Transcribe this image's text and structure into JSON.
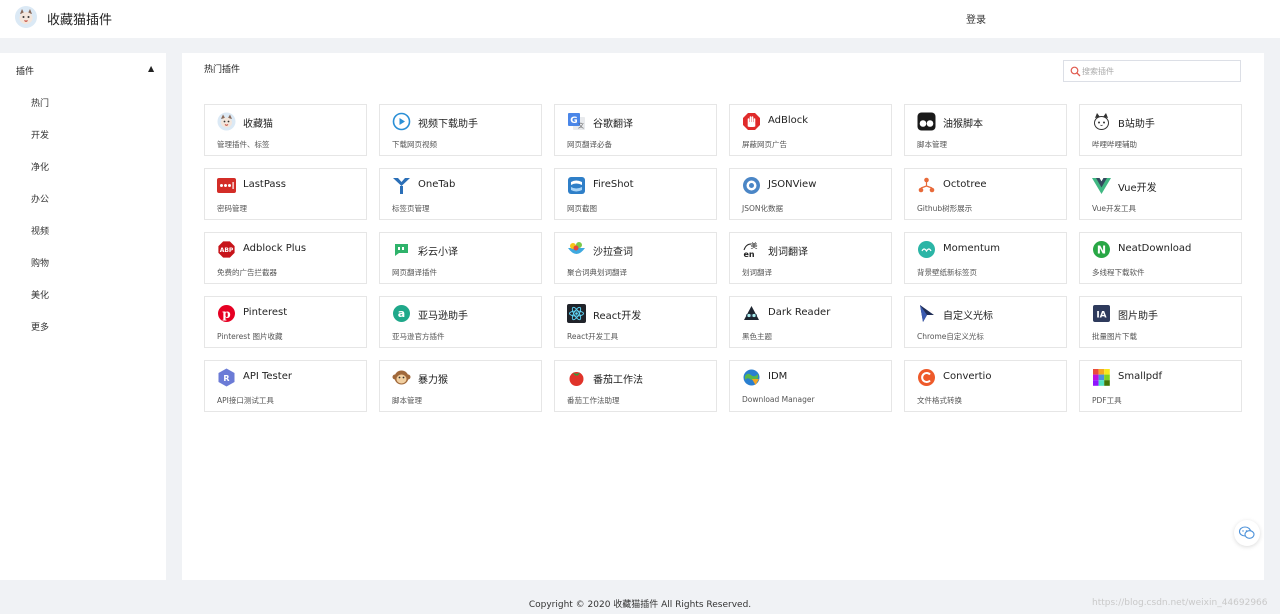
{
  "header": {
    "title": "收藏猫插件",
    "login": "登录"
  },
  "sidebar": {
    "header": "插件",
    "collapse_icon": "caret-up-icon",
    "items": [
      {
        "label": "热门"
      },
      {
        "label": "开发"
      },
      {
        "label": "净化"
      },
      {
        "label": "办公"
      },
      {
        "label": "视频"
      },
      {
        "label": "购物"
      },
      {
        "label": "美化"
      },
      {
        "label": "更多"
      }
    ]
  },
  "main": {
    "title": "热门插件",
    "search": {
      "placeholder": "搜索插件",
      "value": ""
    },
    "plugins": [
      {
        "name": "收藏猫",
        "desc": "管理插件、标签",
        "icon": "cat-logo-icon"
      },
      {
        "name": "视频下载助手",
        "desc": "下载网页视频",
        "icon": "play-circle-icon"
      },
      {
        "name": "谷歌翻译",
        "desc": "网页翻译必备",
        "icon": "google-translate-icon"
      },
      {
        "name": "AdBlock",
        "desc": "屏蔽网页广告",
        "icon": "adblock-hand-icon"
      },
      {
        "name": "油猴脚本",
        "desc": "脚本管理",
        "icon": "tampermonkey-icon"
      },
      {
        "name": "B站助手",
        "desc": "哔哩哔哩辅助",
        "icon": "bilibili-mascot-icon"
      },
      {
        "name": "LastPass",
        "desc": "密码管理",
        "icon": "lastpass-icon"
      },
      {
        "name": "OneTab",
        "desc": "标签页管理",
        "icon": "onetab-funnel-icon"
      },
      {
        "name": "FireShot",
        "desc": "网页截图",
        "icon": "fireshot-icon"
      },
      {
        "name": "JSONView",
        "desc": "JSON化数据",
        "icon": "jsonview-icon"
      },
      {
        "name": "Octotree",
        "desc": "Github树形展示",
        "icon": "octotree-icon"
      },
      {
        "name": "Vue开发",
        "desc": "Vue开发工具",
        "icon": "vue-logo-icon"
      },
      {
        "name": "Adblock Plus",
        "desc": "免费的广告拦截器",
        "icon": "abp-octagon-icon"
      },
      {
        "name": "彩云小译",
        "desc": "网页翻译插件",
        "icon": "caiyun-chat-icon"
      },
      {
        "name": "沙拉查词",
        "desc": "聚合词典划词翻译",
        "icon": "saladict-icon"
      },
      {
        "name": "划词翻译",
        "desc": "划词翻译",
        "icon": "translate-en-icon"
      },
      {
        "name": "Momentum",
        "desc": "背景壁纸新标签页",
        "icon": "momentum-icon"
      },
      {
        "name": "NeatDownload",
        "desc": "多线程下载软件",
        "icon": "neatdownload-icon"
      },
      {
        "name": "Pinterest",
        "desc": "Pinterest 图片收藏",
        "icon": "pinterest-icon"
      },
      {
        "name": "亚马逊助手",
        "desc": "亚马逊官方插件",
        "icon": "amazon-icon"
      },
      {
        "name": "React开发",
        "desc": "React开发工具",
        "icon": "react-atom-icon"
      },
      {
        "name": "Dark Reader",
        "desc": "黑色主题",
        "icon": "dark-reader-icon"
      },
      {
        "name": "自定义光标",
        "desc": "Chrome自定义光标",
        "icon": "cursor-arrow-icon"
      },
      {
        "name": "图片助手",
        "desc": "批量图片下载",
        "icon": "image-assistant-icon"
      },
      {
        "name": "API Tester",
        "desc": "API接口测试工具",
        "icon": "api-tester-icon"
      },
      {
        "name": "暴力猴",
        "desc": "脚本管理",
        "icon": "violentmonkey-icon"
      },
      {
        "name": "番茄工作法",
        "desc": "番茄工作法助理",
        "icon": "tomato-icon"
      },
      {
        "name": "IDM",
        "desc": "Download Manager",
        "icon": "idm-globe-icon"
      },
      {
        "name": "Convertio",
        "desc": "文件格式转换",
        "icon": "convertio-icon"
      },
      {
        "name": "Smallpdf",
        "desc": "PDF工具",
        "icon": "smallpdf-icon"
      }
    ]
  },
  "footer": {
    "copyright": "Copyright © 2020 收藏猫插件 All Rights Reserved."
  },
  "watermark": "https://blog.csdn.net/weixin_44692966",
  "floating": {
    "icon": "wechat-icon"
  }
}
